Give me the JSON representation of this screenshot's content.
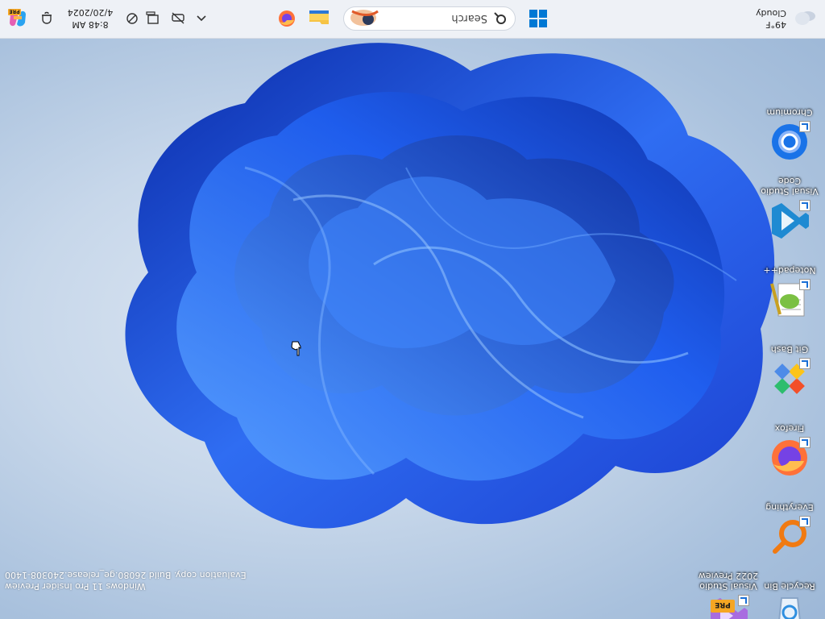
{
  "desktop": {
    "icons": [
      {
        "label": "Chromium",
        "icon": "chromium-icon"
      },
      {
        "label": "Visual Studio Code",
        "icon": "vscode-icon"
      },
      {
        "label": "Notepad++",
        "icon": "notepadpp-icon"
      },
      {
        "label": "Git Bash",
        "icon": "git-bash-icon"
      },
      {
        "label": "Firefox",
        "icon": "firefox-icon"
      },
      {
        "label": "Everything",
        "icon": "everything-icon"
      },
      {
        "label": "Recycle Bin",
        "icon": "recycle-bin-icon"
      },
      {
        "label": "Visual Studio 2022 Preview",
        "icon": "visual-studio-preview-icon",
        "badge": "PRE"
      }
    ],
    "watermark": {
      "line1": "Windows 11 Pro Insider Preview",
      "line2": "Evaluation copy. Build 26080.ge_release.240308-1400"
    }
  },
  "taskbar": {
    "weather": {
      "temp": "49°F",
      "condition": "Cloudy"
    },
    "search": {
      "placeholder": "Search"
    },
    "clock": {
      "time": "8:48 AM",
      "date": "4/20/2024"
    },
    "copilot_badge": "PRE",
    "colors": {
      "background": "#eef1f6",
      "accent": "#0078d4"
    }
  }
}
